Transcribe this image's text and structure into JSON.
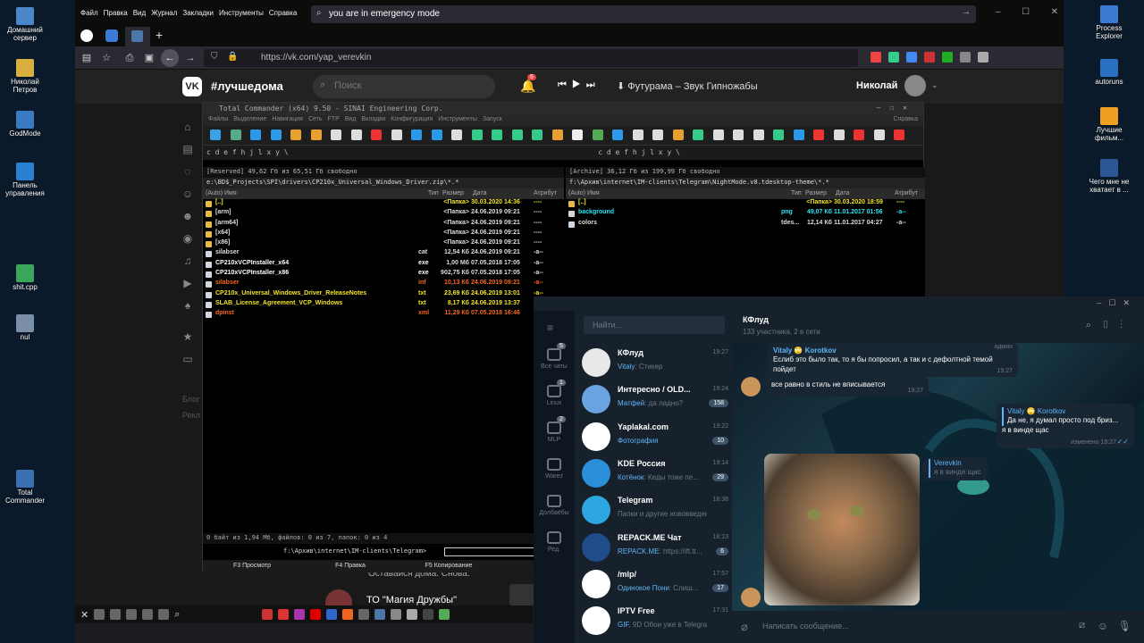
{
  "desktop": {
    "left_icons": [
      {
        "label": "Домашний сервер"
      },
      {
        "label": "Николай Петров"
      },
      {
        "label": "GodMode"
      },
      {
        "label": "Панель управления"
      },
      {
        "label": "shit.cpp"
      },
      {
        "label": "nul"
      },
      {
        "label": "Total Commander"
      }
    ],
    "right_icons": [
      {
        "label": "Process Explorer"
      },
      {
        "label": "autoruns"
      },
      {
        "label": "Лучшие фильм..."
      },
      {
        "label": "Чего мне не хватает в ..."
      }
    ]
  },
  "firefox": {
    "menu": [
      "Файл",
      "Правка",
      "Вид",
      "Журнал",
      "Закладки",
      "Инструменты",
      "Справка"
    ],
    "search_text": "you are in emergency mode",
    "url": "https://vk.com/yap_verevkin"
  },
  "vk": {
    "logo": "VK",
    "hashtag": "#лучшедома",
    "search_placeholder": "Поиск",
    "notifications": "6",
    "track": "Футурама – Звук Гипножабы",
    "user": "Николай",
    "left_text1": "Блог",
    "left_text2": "Рекл",
    "bottom_text": "Оставайся дома. Снова.",
    "post_title": "ТО \"Магия Дружбы\""
  },
  "tc": {
    "title": "Total Commander (x64) 9.50 - SINAI Engineering Corp.",
    "menu": [
      "Файлы",
      "Выделение",
      "Навигация",
      "Сеть",
      "FTP",
      "Вид",
      "Вкладки",
      "Конфигурация",
      "Инструменты",
      "Запуск"
    ],
    "help": "Справка",
    "left": {
      "drive_info": "[Reserved]  49,62 Гб из 65,51 Гб свободно",
      "path": "e:\\BD$_Projects\\SPI\\drivers\\CP210x_Universal_Windows_Driver.zip\\*.*",
      "headers": [
        "(Auto) Имя",
        "Тип",
        "Размер",
        "Дата",
        "Атрибут"
      ],
      "rows": [
        {
          "name": "[..]",
          "ext": "",
          "size": "<Папка>",
          "date": "30.03.2020 14:36",
          "attr": "----",
          "color": "#f1e42b"
        },
        {
          "name": "[arm]",
          "ext": "",
          "size": "<Папка>",
          "date": "24.06.2019 09:21",
          "attr": "----",
          "color": "#dddddd"
        },
        {
          "name": "[arm64]",
          "ext": "",
          "size": "<Папка>",
          "date": "24.06.2019 09:21",
          "attr": "----",
          "color": "#dddddd"
        },
        {
          "name": "[x64]",
          "ext": "",
          "size": "<Папка>",
          "date": "24.06.2019 09:21",
          "attr": "----",
          "color": "#dddddd"
        },
        {
          "name": "[x86]",
          "ext": "",
          "size": "<Папка>",
          "date": "24.06.2019 09:21",
          "attr": "----",
          "color": "#dddddd"
        },
        {
          "name": "silabser",
          "ext": "cat",
          "size": "12,54 Кб",
          "date": "24.06.2019 09:21",
          "attr": "-a--",
          "color": "#dddddd"
        },
        {
          "name": "CP210xVCPInstaller_x64",
          "ext": "exe",
          "size": "1,00 Мб",
          "date": "07.05.2018 17:05",
          "attr": "-a--",
          "color": "#ffffff"
        },
        {
          "name": "CP210xVCPInstaller_x86",
          "ext": "exe",
          "size": "902,75 Кб",
          "date": "07.05.2018 17:05",
          "attr": "-a--",
          "color": "#ffffff"
        },
        {
          "name": "silabser",
          "ext": "inf",
          "size": "10,13 Кб",
          "date": "24.06.2019 09:21",
          "attr": "-a--",
          "color": "#f46a1e"
        },
        {
          "name": "CP210x_Universal_Windows_Driver_ReleaseNotes",
          "ext": "txt",
          "size": "23,69 Кб",
          "date": "24.06.2019 13:01",
          "attr": "-a--",
          "color": "#f1e42b"
        },
        {
          "name": "SLAB_License_Agreement_VCP_Windows",
          "ext": "txt",
          "size": "8,17 Кб",
          "date": "24.06.2019 13:37",
          "attr": "-a--",
          "color": "#f1e42b"
        },
        {
          "name": "dpinst",
          "ext": "xml",
          "size": "11,29 Кб",
          "date": "07.05.2018 16:46",
          "attr": "-a--",
          "color": "#f46a1e"
        }
      ]
    },
    "right": {
      "drive_info": "[Archive]  36,12 Гб из 199,99 Гб свободно",
      "path": "f:\\Архив\\internet\\IM-clients\\Telegram\\NightMode.v8.tdesktop-theme\\*.*",
      "headers": [
        "(Auto) Имя",
        "Тип",
        "Размер",
        "Дата",
        "Атрибут"
      ],
      "rows": [
        {
          "name": "[..]",
          "ext": "",
          "size": "<Папка>",
          "date": "30.03.2020 18:59",
          "attr": "----",
          "color": "#f1e42b"
        },
        {
          "name": "background",
          "ext": "png",
          "size": "49,07 Кб",
          "date": "11.01.2017 01:56",
          "attr": "-a--",
          "color": "#2ee3f5"
        },
        {
          "name": "colors",
          "ext": "tdes...",
          "size": "12,14 Кб",
          "date": "11.01.2017 04:27",
          "attr": "-a--",
          "color": "#dddddd"
        }
      ]
    },
    "status": "0 байт из 1,94 Мб, файлов: 0 из 7, папок: 0 из 4",
    "cmdline": "f:\\Архив\\internet\\IM-clients\\Telegram>",
    "fkeys": [
      "F3 Просмотр",
      "F4 Правка",
      "F5 Копирование"
    ]
  },
  "telegram": {
    "search_placeholder": "Найти...",
    "chat_title": "КФлуд",
    "chat_subtitle": "133 участника, 2 в сети",
    "folders": [
      {
        "label": "Все чаты",
        "badge": "5"
      },
      {
        "label": "Linux",
        "badge": "1"
      },
      {
        "label": "MLP",
        "badge": "2"
      },
      {
        "label": "Warez",
        "badge": ""
      },
      {
        "label": "Долбаёбы",
        "badge": ""
      },
      {
        "label": "Ред.",
        "badge": ""
      }
    ],
    "chats": [
      {
        "name": "КФлуд",
        "time": "19:27",
        "sender": "Vitaly",
        "preview": ": Стикер",
        "count": "",
        "color": "#e8e8e8"
      },
      {
        "name": "Интересно / OLD...",
        "time": "19:24",
        "sender": "Матфей",
        "preview": ": да ладно?",
        "count": "158",
        "color": "#6aa3e0"
      },
      {
        "name": "Yaplakal.com",
        "time": "19:22",
        "sender": "Фотография",
        "preview": "",
        "count": "10",
        "color": "#ffffff"
      },
      {
        "name": "KDE Россия",
        "time": "19:14",
        "sender": "Котёнок",
        "preview": ": Кеды тоже пе...",
        "count": "29",
        "color": "#2a8fd8"
      },
      {
        "name": "Telegram",
        "time": "18:38",
        "sender": "",
        "preview": "Папки и другие нововведен...",
        "count": "",
        "color": "#2ea6df"
      },
      {
        "name": "REPACK.ME Чат",
        "time": "18:13",
        "sender": "REPACK.ME",
        "preview": ": https://ift.tt...",
        "count": "6",
        "color": "#1f4d8a"
      },
      {
        "name": "/mlp/",
        "time": "17:57",
        "sender": "Одинокое Пони",
        "preview": ": Слиш...",
        "count": "17",
        "color": "#ffffff"
      },
      {
        "name": "IPTV Free",
        "time": "17:31",
        "sender": "GIF",
        "preview": ", 9D Обои уже в Telegra...",
        "count": "",
        "color": "#ffffff"
      }
    ],
    "messages": {
      "m1_sender": "Vitaly",
      "m1_reply": "Korotkov",
      "m1_admin": "админ",
      "m1_text": "Еслиб это было так, то я бы попросил, а так и с дефолтной темой пойдет",
      "m1_time": "19:27",
      "m2_text": "все равно в стиль не вписывается",
      "m2_time": "19:27",
      "m3_reply_name": "Vitaly",
      "m3_reply_name2": "Korotkov",
      "m3_reply_text": "Да не, я думал просто под бриз...",
      "m3_text": "я в винде щас",
      "m3_time": "изменено 19:27",
      "m4_reply_name": "Verevkin",
      "m4_reply_text": "я в винде щас"
    },
    "input_placeholder": "Написать сообщение..."
  }
}
